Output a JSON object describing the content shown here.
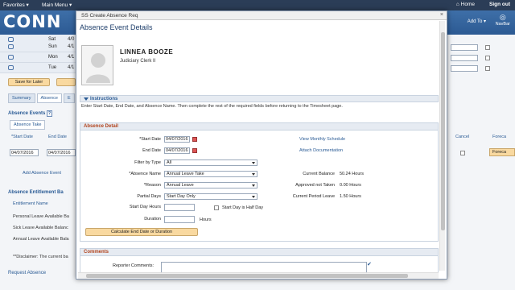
{
  "sysbar": {
    "favorites": "Favorites",
    "main_menu": "Main Menu",
    "home": "Home",
    "sign_out": "Sign out"
  },
  "header": {
    "logo": "CONN",
    "add_to": "Add To",
    "navbar": "NavBar"
  },
  "background": {
    "rows": [
      {
        "day": "Sat",
        "date": "4/0"
      },
      {
        "day": "Sun",
        "date": "4/1"
      },
      {
        "day": "Mon",
        "date": "4/1"
      },
      {
        "day": "Tue",
        "date": "4/1"
      }
    ],
    "save_for_later": "Save for Later",
    "tabs": [
      "Summary",
      "Absence",
      "E"
    ],
    "absence_events_title": "Absence Events",
    "absence_take_tab": "Absence Take",
    "start_date_col": "*Start Date",
    "end_date_col": "End Date",
    "start_date_val": "04/07/2016",
    "end_date_val": "04/07/2016",
    "add_absence_event": "Add Absence Event",
    "entitlement_title": "Absence Entitlement Ba",
    "entitlement_name_col": "Entitlement Name",
    "entitlement_rows": [
      "Personal Leave Available Ba",
      "Sick Leave Available Balanc",
      "Annual Leave Available Bala"
    ],
    "disclaimer": "**Disclaimer: The current ba",
    "request_absence": "Request Absence",
    "cancel_col": "Cancel",
    "forecast_col": "Foreca",
    "forecast_btn": "Foreca"
  },
  "modal": {
    "title": "SS Create Absence Req",
    "page_title": "Absence Event Details",
    "employee_name": "LINNEA BOOZE",
    "employee_title": "Judiciary Clerk II",
    "instructions_label": "Instructions",
    "instructions_text": "Enter Start Date, End Date, and Absence Name. Then complete the rest of the required fields before returning to the Timesheet page.",
    "detail_label": "Absence Detail",
    "fields": {
      "start_date_label": "*Start Date",
      "start_date": "04/07/2016",
      "end_date_label": "End Date",
      "end_date": "04/07/2016",
      "filter_label": "Filter by Type",
      "filter_value": "All",
      "absence_name_label": "*Absence Name",
      "absence_name_value": "Annual Leave Take",
      "reason_label": "*Reason",
      "reason_value": "Annual Leave",
      "partial_days_label": "Partial Days",
      "partial_days_value": "Start Day Only",
      "start_day_hours_label": "Start Day Hours",
      "start_day_half_label": "Start Day is Half Day",
      "duration_label": "Duration",
      "hours_label": "Hours"
    },
    "links": {
      "view_schedule": "View Monthly Schedule",
      "attach_doc": "Attach Documentation"
    },
    "balances": [
      {
        "label": "Current Balance",
        "value": "50.24 Hours"
      },
      {
        "label": "Approved not Taken",
        "value": "0.00 Hours"
      },
      {
        "label": "Current Period Leave",
        "value": "1.50 Hours"
      }
    ],
    "calc_button": "Calculate End Date or Duration",
    "comments_label": "Comments",
    "reporter_comments_label": "Reporter Comments:"
  }
}
